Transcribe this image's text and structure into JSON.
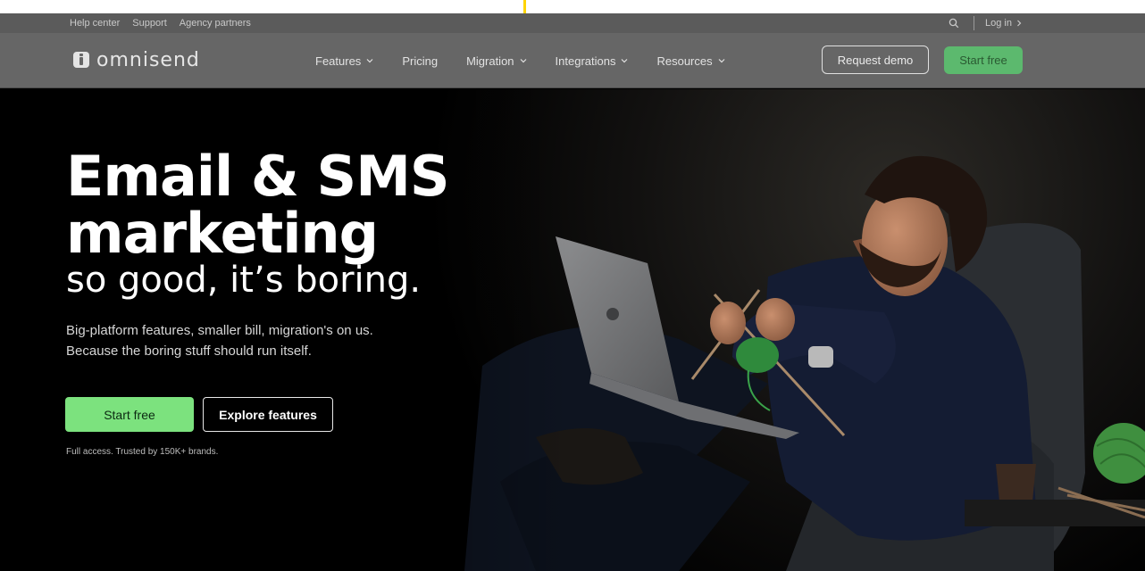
{
  "utility_bar": {
    "links": [
      "Help center",
      "Support",
      "Agency partners"
    ],
    "search_icon": "search-icon",
    "login_label": "Log in"
  },
  "nav": {
    "logo_text": "omnisend",
    "items": [
      {
        "label": "Features",
        "has_dropdown": true
      },
      {
        "label": "Pricing",
        "has_dropdown": false
      },
      {
        "label": "Migration",
        "has_dropdown": true
      },
      {
        "label": "Integrations",
        "has_dropdown": true
      },
      {
        "label": "Resources",
        "has_dropdown": true
      }
    ],
    "request_demo_label": "Request demo",
    "start_free_label": "Start free"
  },
  "hero": {
    "headline_line1": "Email & SMS",
    "headline_line2": "marketing",
    "subhead": "so good, it’s boring.",
    "description_line1": "Big-platform features, smaller bill, migration's on us.",
    "description_line2": "Because the boring stuff should run itself.",
    "start_free_label": "Start free",
    "explore_label": "Explore features",
    "trust_text": "Full access. Trusted by 150K+ brands."
  },
  "colors": {
    "accent_green": "#7ce27e",
    "nav_bg": "#666666",
    "utility_bg": "#5b5b5b",
    "hero_bg": "#000000"
  }
}
